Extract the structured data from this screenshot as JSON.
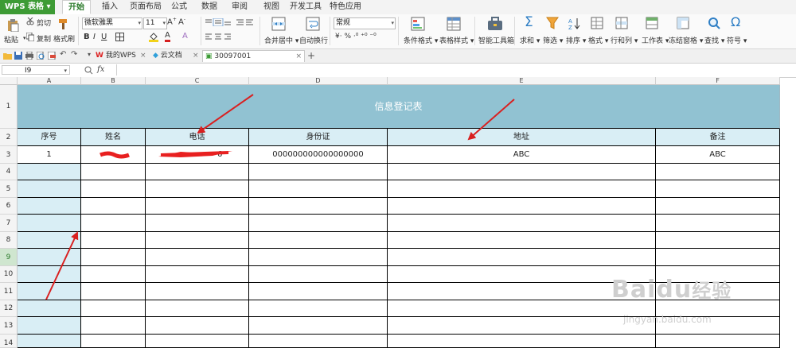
{
  "app": {
    "name": "WPS 表格"
  },
  "ribbon_tabs": [
    "开始",
    "插入",
    "页面布局",
    "公式",
    "数据",
    "审阅",
    "视图",
    "开发工具",
    "特色应用"
  ],
  "active_tab": "开始",
  "ribbon": {
    "paste": "粘贴",
    "cut": "剪切",
    "copy": "复制",
    "format_painter": "格式刷",
    "font_name": "微软雅黑",
    "font_size": "11",
    "number_format": "常规",
    "merge_center": "合并居中",
    "wrap_text": "自动换行",
    "conditional_format": "条件格式",
    "table_style": "表格样式",
    "smart_toolbox": "智能工具箱",
    "sum": "求和",
    "filter": "筛选",
    "sort": "排序",
    "format": "格式",
    "rows_cols": "行和列",
    "worksheet": "工作表",
    "freeze": "冻结窗格",
    "find": "查找",
    "symbol": "符号"
  },
  "doc_tabs": [
    {
      "label": "我的WPS"
    },
    {
      "label": "云文档"
    },
    {
      "label": "30097001"
    }
  ],
  "formula_bar": {
    "cell_ref": "I9",
    "fx": "fx",
    "content": ""
  },
  "columns": [
    "A",
    "B",
    "C",
    "D",
    "E",
    "F"
  ],
  "rows": [
    "1",
    "2",
    "3",
    "4",
    "5",
    "6",
    "7",
    "8",
    "9",
    "10",
    "11",
    "12",
    "13",
    "14"
  ],
  "selected_row": "9",
  "sheet": {
    "title": "信息登记表",
    "headers": [
      "序号",
      "姓名",
      "电话",
      "身份证",
      "地址",
      "备注"
    ],
    "row3": [
      "1",
      "",
      "",
      "000000000000000000",
      "ABC",
      "ABC"
    ],
    "phone_visible_suffix": "6"
  },
  "colors": {
    "title_fill": "#91c2d2",
    "header_fill": "#d9eef5",
    "accent": "#3d9b35",
    "annotation": "#d92020"
  },
  "watermark": {
    "brand": "Baidu",
    "brand_cn": "经验",
    "url": "jingyan.baidu.com"
  }
}
